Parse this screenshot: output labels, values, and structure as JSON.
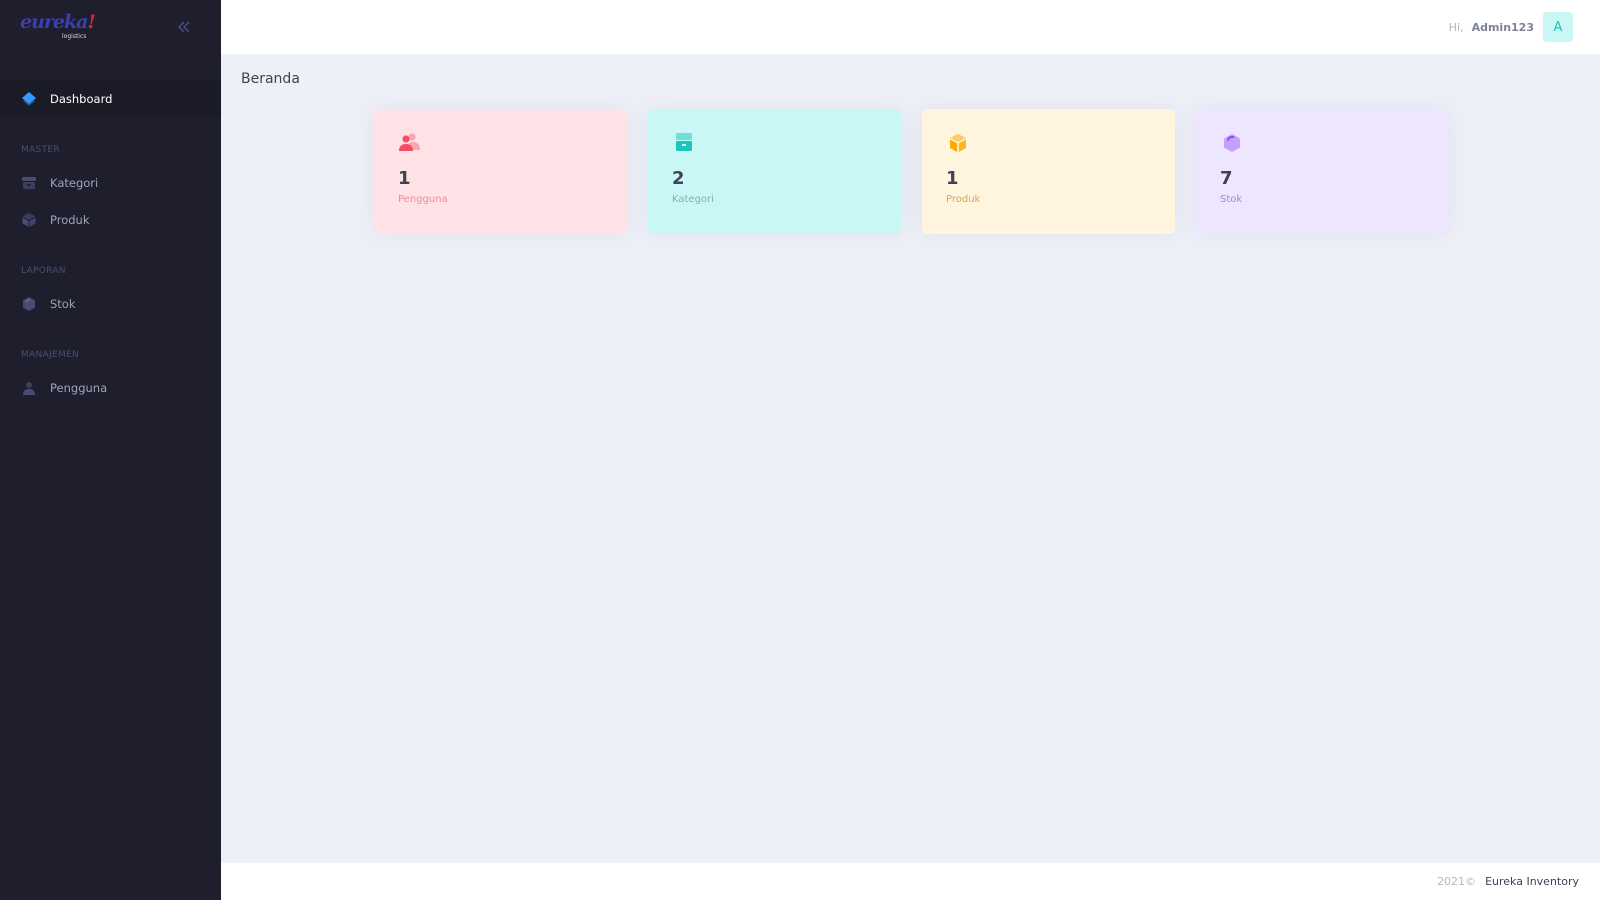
{
  "sidebar": {
    "logo_text": "eureka",
    "logo_bang": "!",
    "logo_sub": "logistics",
    "toggle_icon": "chevron-double-left-icon",
    "items": [
      {
        "label": "Dashboard",
        "icon": "layers-icon",
        "active": true
      }
    ],
    "sections": [
      {
        "title": "MASTER",
        "items": [
          {
            "label": "Kategori",
            "icon": "archive-icon"
          },
          {
            "label": "Produk",
            "icon": "box-icon"
          }
        ]
      },
      {
        "title": "LAPORAN",
        "items": [
          {
            "label": "Stok",
            "icon": "cube-icon"
          }
        ]
      },
      {
        "title": "MANAJEMEN",
        "items": [
          {
            "label": "Pengguna",
            "icon": "user-icon"
          }
        ]
      }
    ]
  },
  "header": {
    "greeting": "Hi,",
    "username": "Admin123",
    "avatar_letter": "A"
  },
  "main": {
    "title": "Beranda",
    "cards": [
      {
        "value": "1",
        "label": "Pengguna",
        "icon": "users-icon",
        "bg": "#ffe2e5",
        "accent": "#f64e60"
      },
      {
        "value": "2",
        "label": "Kategori",
        "icon": "archive-icon",
        "bg": "#c9f7f5",
        "accent": "#1bc5bd"
      },
      {
        "value": "1",
        "label": "Produk",
        "icon": "box-icon",
        "bg": "#fff4de",
        "accent": "#ffa800"
      },
      {
        "value": "7",
        "label": "Stok",
        "icon": "cube-icon",
        "bg": "#eee5ff",
        "accent": "#8950fc"
      }
    ]
  },
  "footer": {
    "year": "2021©",
    "name": "Eureka Inventory"
  },
  "colors": {
    "sidebar_bg": "#1e1e2d",
    "page_bg": "#eef0f8",
    "primary": "#3699ff"
  }
}
